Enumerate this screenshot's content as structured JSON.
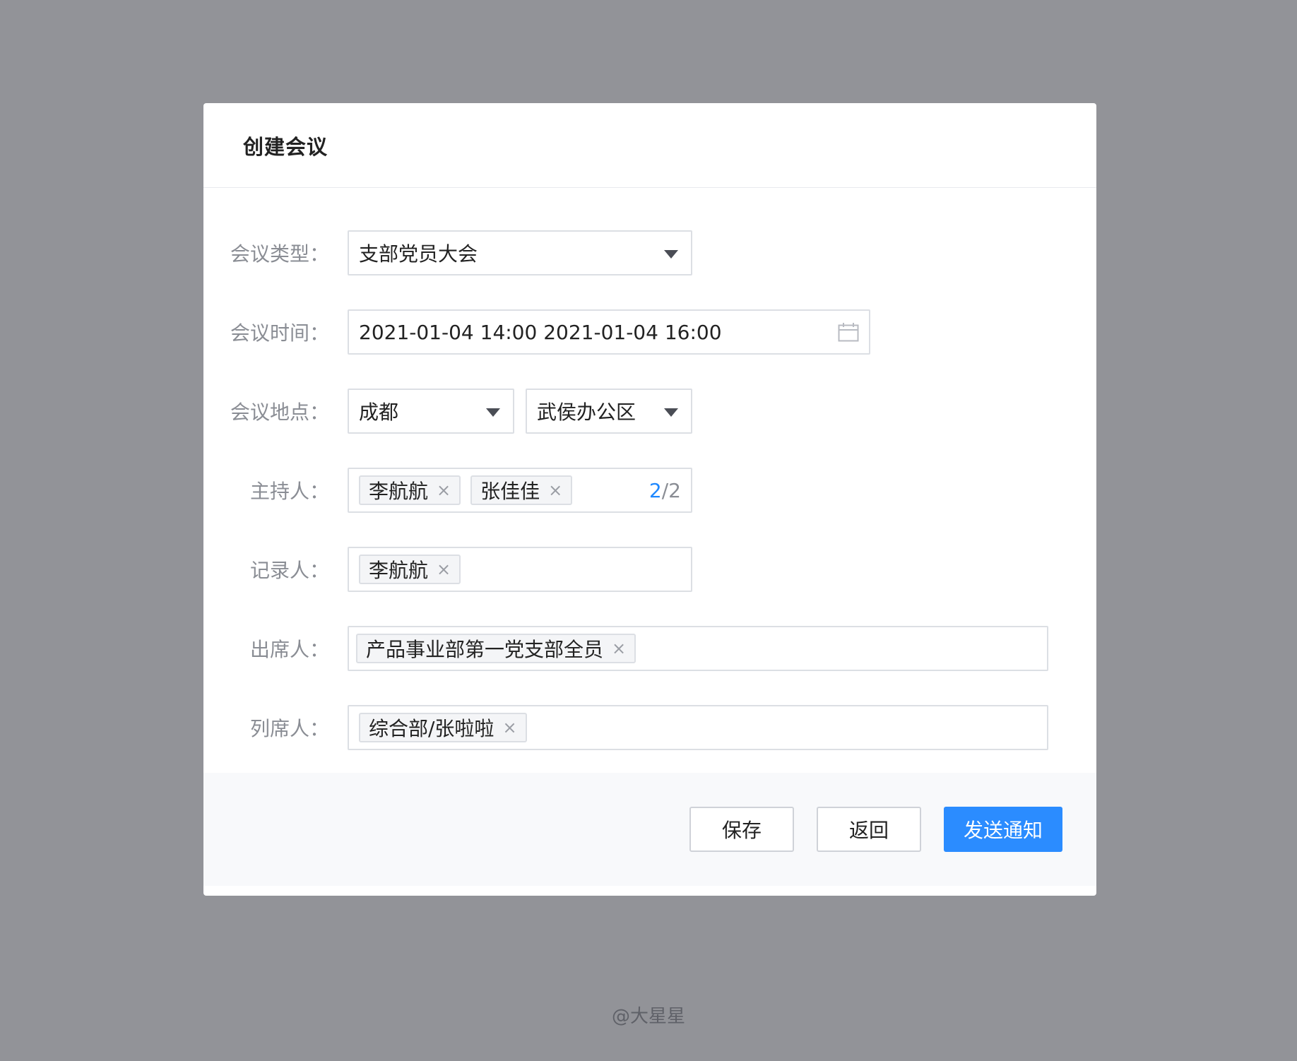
{
  "dialog": {
    "title": "创建会议"
  },
  "form": {
    "meeting_type": {
      "label": "会议类型：",
      "value": "支部党员大会"
    },
    "meeting_time": {
      "label": "会议时间：",
      "value": "2021-01-04  14:00  2021-01-04  16:00"
    },
    "meeting_location": {
      "label": "会议地点：",
      "city": "成都",
      "office": "武侯办公区"
    },
    "host": {
      "label": "主持人：",
      "tags": [
        "李航航",
        "张佳佳"
      ],
      "count_current": "2",
      "count_total": "/2"
    },
    "recorder": {
      "label": "记录人：",
      "tags": [
        "李航航"
      ]
    },
    "attendees": {
      "label": "出席人：",
      "tags": [
        "产品事业部第一党支部全员"
      ]
    },
    "observers": {
      "label": "列席人：",
      "tags": [
        "综合部/张啦啦"
      ]
    }
  },
  "tag_close_glyph": "×",
  "footer": {
    "save_label": "保存",
    "back_label": "返回",
    "send_label": "发送通知"
  },
  "watermark": "@大星星",
  "colors": {
    "overlay": "#929398",
    "primary": "#2b8cff",
    "counter_accent": "#1e88ff"
  }
}
